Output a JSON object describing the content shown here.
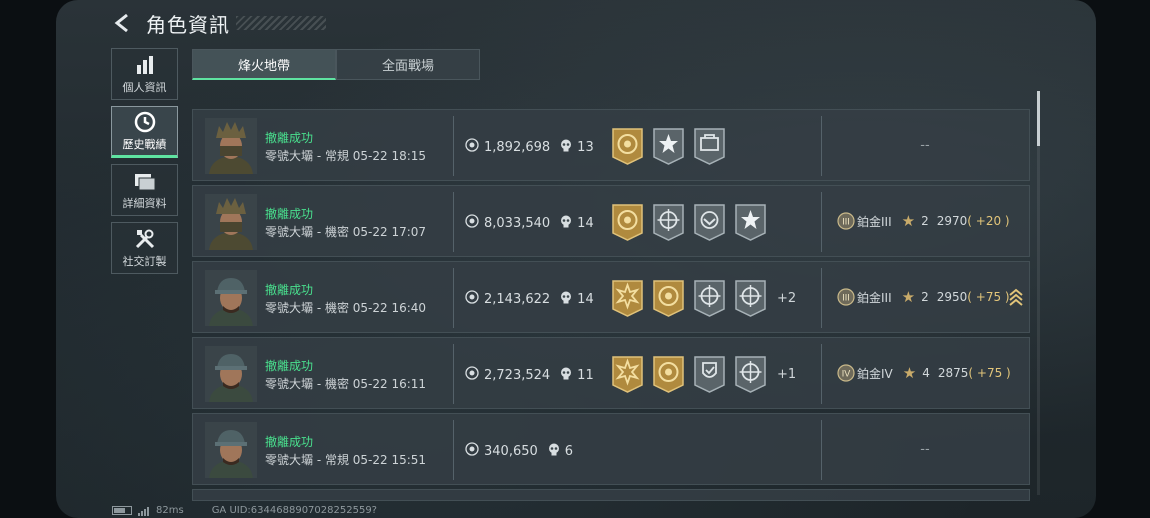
{
  "header": {
    "title": "角色資訊"
  },
  "sidebar": {
    "items": [
      {
        "label": "個人資訊",
        "icon": "bar-chart-icon",
        "active": false
      },
      {
        "label": "歷史戰績",
        "icon": "clock-icon",
        "active": true
      },
      {
        "label": "詳細資料",
        "icon": "folder-icon",
        "active": false
      },
      {
        "label": "社交訂製",
        "icon": "tools-icon",
        "active": false
      }
    ]
  },
  "tabs": [
    {
      "label": "烽火地帶",
      "active": true
    },
    {
      "label": "全面戰場",
      "active": false
    }
  ],
  "matches": [
    {
      "avatar": "armored-operator-avatar",
      "status": "撤離成功",
      "subtitle": "零號大壩 - 常規 05-22 18:15",
      "score": "1,892,698",
      "kills": "13",
      "medals": [
        "gold-medal",
        "star-medal",
        "bag-medal"
      ],
      "more": "",
      "rank": null,
      "rank_empty": "--"
    },
    {
      "avatar": "armored-operator-avatar",
      "status": "撤離成功",
      "subtitle": "零號大壩 - 機密 05-22 17:07",
      "score": "8,033,540",
      "kills": "14",
      "medals": [
        "gold-medal",
        "target-medal",
        "rescue-medal",
        "star-medal"
      ],
      "more": "",
      "rank": {
        "badge": "III",
        "name": "鉑金III",
        "stars": "2",
        "points": "2970",
        "delta": "+20"
      },
      "rank_empty": ""
    },
    {
      "avatar": "cap-operator-avatar",
      "status": "撤離成功",
      "subtitle": "零號大壩 - 機密 05-22 16:40",
      "score": "2,143,622",
      "kills": "14",
      "medals": [
        "burst-gold-medal",
        "gold-medal",
        "target-medal",
        "target-medal"
      ],
      "more": "+2",
      "rank": {
        "badge": "III",
        "name": "鉑金III",
        "stars": "2",
        "points": "2950",
        "delta": "+75",
        "chevron": true
      },
      "rank_empty": ""
    },
    {
      "avatar": "cap-operator-avatar",
      "status": "撤離成功",
      "subtitle": "零號大壩 - 機密 05-22 16:11",
      "score": "2,723,524",
      "kills": "11",
      "medals": [
        "burst-gold-medal",
        "gold-medal",
        "shield-medal",
        "target-medal"
      ],
      "more": "+1",
      "rank": {
        "badge": "IV",
        "name": "鉑金IV",
        "stars": "4",
        "points": "2875",
        "delta": "+75"
      },
      "rank_empty": ""
    },
    {
      "avatar": "cap-operator-avatar",
      "status": "撤離成功",
      "subtitle": "零號大壩 - 常規 05-22 15:51",
      "score": "340,650",
      "kills": "6",
      "medals": [],
      "more": "",
      "rank": null,
      "rank_empty": "--"
    }
  ],
  "footer": {
    "ping": "82ms",
    "uid": "GA UID:6344688907028252559?"
  },
  "colors": {
    "accent": "#5fe3a1",
    "success": "#49e08e",
    "gold": "#c9ab6a",
    "delta": "#e2c57a"
  }
}
